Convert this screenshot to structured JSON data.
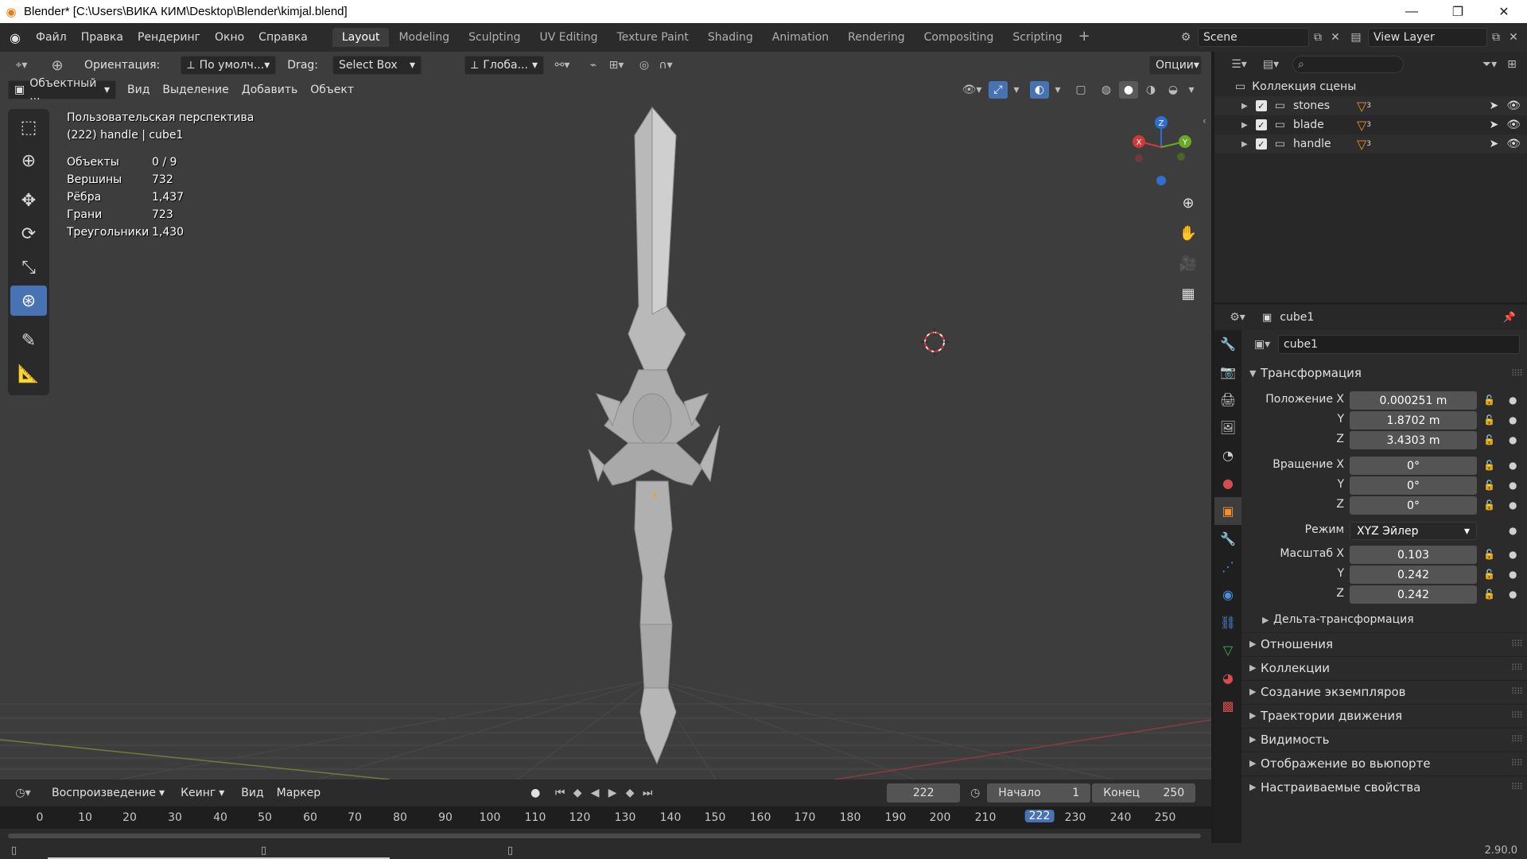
{
  "titlebar": {
    "title": "Blender* [C:\\Users\\ВИКА КИМ\\Desktop\\Blender\\kimjal.blend]",
    "min": "—",
    "max": "❐",
    "close": "✕"
  },
  "menu": [
    "Файл",
    "Правка",
    "Рендеринг",
    "Окно",
    "Справка"
  ],
  "workspaces": [
    "Layout",
    "Modeling",
    "Sculpting",
    "UV Editing",
    "Texture Paint",
    "Shading",
    "Animation",
    "Rendering",
    "Compositing",
    "Scripting"
  ],
  "active_workspace": "Layout",
  "scene": {
    "name": "Scene",
    "view_layer": "View Layer"
  },
  "viewport": {
    "orientation_label": "Ориентация:",
    "orientation_value": "По умолч...",
    "drag_label": "Drag:",
    "drag_value": "Select Box",
    "transform_value": "Глоба...",
    "options_label": "Опции",
    "mode": "Объектный ...",
    "menus": [
      "Вид",
      "Выделение",
      "Добавить",
      "Объект"
    ],
    "info_line1": "Пользовательская перспектива",
    "info_line2": "(222) handle | cube1",
    "stats": [
      {
        "k": "Объекты",
        "v": "0 / 9"
      },
      {
        "k": "Вершины",
        "v": "732"
      },
      {
        "k": "Рёбра",
        "v": "1,437"
      },
      {
        "k": "Грани",
        "v": "723"
      },
      {
        "k": "Треугольники",
        "v": "1,430"
      }
    ],
    "gizmo": {
      "x": "X",
      "y": "Y",
      "z": "Z"
    }
  },
  "outliner": {
    "root": "Коллекция сцены",
    "items": [
      {
        "name": "stones",
        "badge": "3"
      },
      {
        "name": "blade",
        "badge": "3"
      },
      {
        "name": "handle",
        "badge": "3"
      }
    ]
  },
  "properties": {
    "object_name": "cube1",
    "datablock_name": "cube1",
    "transform_title": "Трансформация",
    "location": {
      "label_x": "Положение X",
      "x": "0.000251 m",
      "y": "1.8702 m",
      "z": "3.4303 m"
    },
    "rotation": {
      "label_x": "Вращение X",
      "x": "0°",
      "y": "0°",
      "z": "0°"
    },
    "mode_label": "Режим",
    "mode_value": "XYZ Эйлер",
    "scale": {
      "label_x": "Масштаб X",
      "x": "0.103",
      "y": "0.242",
      "z": "0.242"
    },
    "axis_y": "Y",
    "axis_z": "Z",
    "delta": "Дельта-трансформация",
    "panels": [
      "Отношения",
      "Коллекции",
      "Создание экземпляров",
      "Траектории движения",
      "Видимость",
      "Отображение во вьюпорте",
      "Настраиваемые свойства"
    ]
  },
  "timeline": {
    "menus": [
      "Воспроизведение",
      "Кеинг",
      "Вид",
      "Маркер"
    ],
    "current_frame": "222",
    "start_label": "Начало",
    "start_value": "1",
    "end_label": "Конец",
    "end_value": "250",
    "ticks": [
      "0",
      "10",
      "20",
      "30",
      "40",
      "50",
      "60",
      "70",
      "80",
      "90",
      "100",
      "110",
      "120",
      "130",
      "140",
      "150",
      "160",
      "170",
      "180",
      "190",
      "200",
      "210",
      "230",
      "240",
      "250"
    ],
    "cursor_label": "222"
  },
  "statusbar": {
    "version": "2.90.0"
  },
  "colors": {
    "accent": "#4772b3",
    "viewport_bg": "#3d3d3d",
    "panel_bg": "#2b2b2b"
  }
}
